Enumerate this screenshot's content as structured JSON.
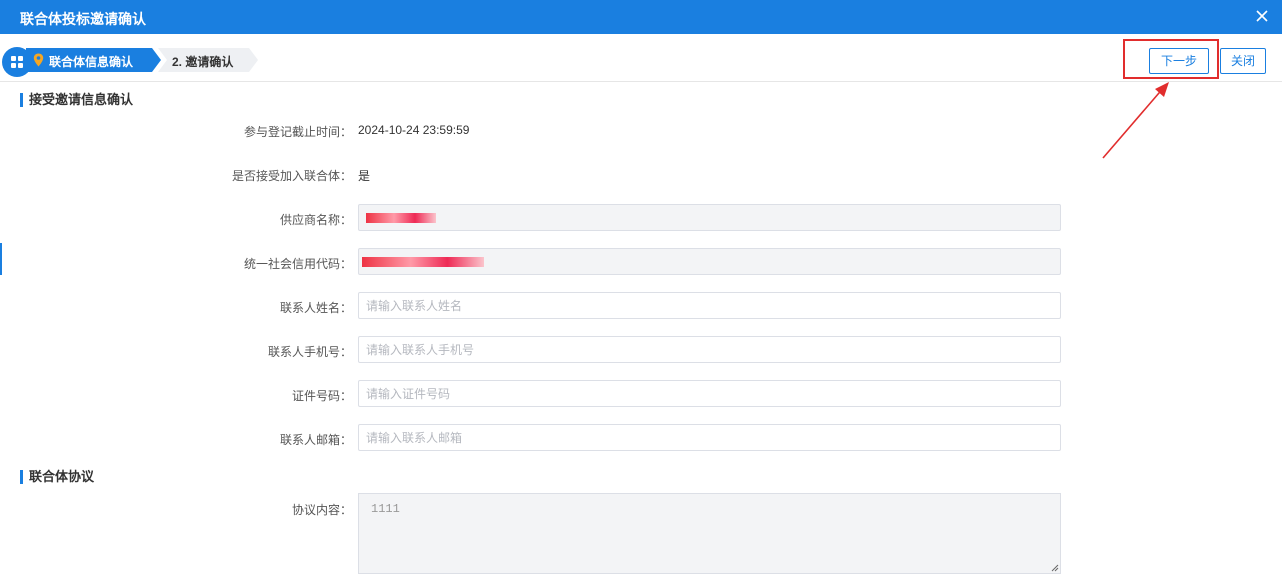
{
  "dialog": {
    "title": "联合体投标邀请确认"
  },
  "steps": [
    {
      "label": "联合体信息确认",
      "active": true
    },
    {
      "label": "2. 邀请确认",
      "active": false
    }
  ],
  "buttons": {
    "next": "下一步",
    "close": "关闭"
  },
  "section1": {
    "heading": "接受邀请信息确认",
    "fields": {
      "deadline": {
        "label": "参与登记截止时间：",
        "value": "2024-10-24 23:59:59"
      },
      "accept": {
        "label": "是否接受加入联合体：",
        "value": "是"
      },
      "supplier": {
        "label": "供应商名称："
      },
      "credit_code": {
        "label": "统一社会信用代码："
      },
      "contact_name": {
        "label": "联系人姓名：",
        "placeholder": "请输入联系人姓名",
        "value": ""
      },
      "contact_phone": {
        "label": "联系人手机号：",
        "placeholder": "请输入联系人手机号",
        "value": ""
      },
      "id_number": {
        "label": "证件号码：",
        "placeholder": "请输入证件号码",
        "value": ""
      },
      "contact_email": {
        "label": "联系人邮箱：",
        "placeholder": "请输入联系人邮箱",
        "value": ""
      }
    }
  },
  "section2": {
    "heading": "联合体协议",
    "agreement": {
      "label": "协议内容：",
      "value": "1111"
    }
  },
  "colors": {
    "primary": "#1a7fe0",
    "highlight": "#e12d2d",
    "readonly_bg": "#f3f4f6"
  },
  "icons": [
    "close-icon",
    "grid-icon",
    "location-pin-icon",
    "resize-grip-icon"
  ]
}
